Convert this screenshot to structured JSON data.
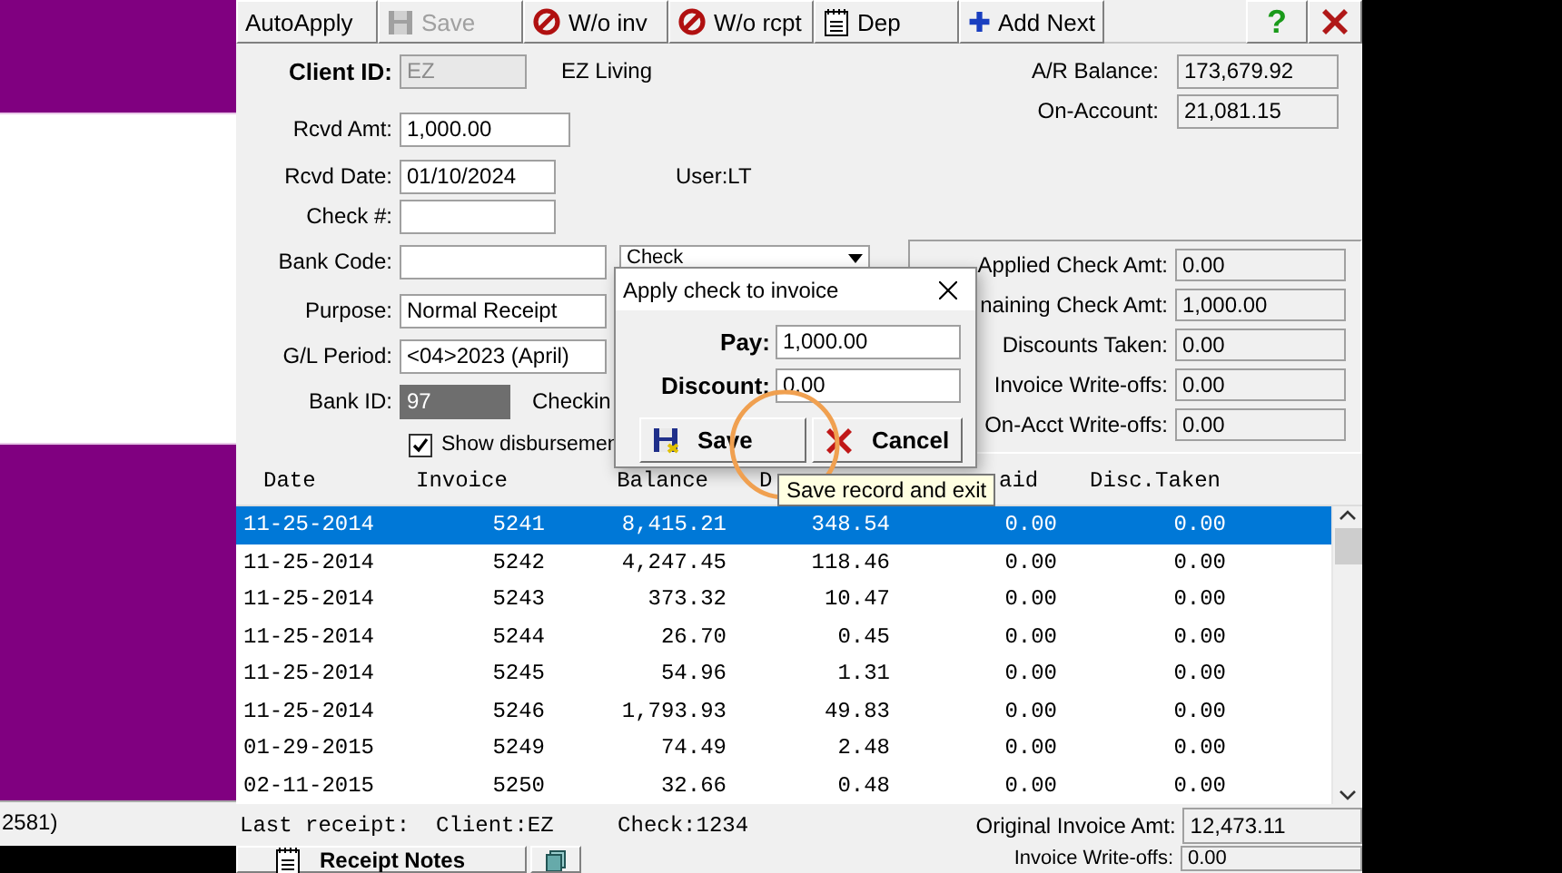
{
  "side_panel": {
    "status_text": "2581)"
  },
  "toolbar": {
    "buttons": [
      {
        "label": "AutoApply",
        "kind": "text",
        "disabled": false
      },
      {
        "label": "Save",
        "kind": "save",
        "disabled": true
      },
      {
        "label": "W/o inv",
        "kind": "writeoff",
        "disabled": false
      },
      {
        "label": "W/o rcpt",
        "kind": "writeoff",
        "disabled": false
      },
      {
        "label": "Dep",
        "kind": "notepad",
        "disabled": false
      },
      {
        "label": "Add Next",
        "kind": "plus",
        "disabled": false
      }
    ],
    "help": "?"
  },
  "form": {
    "client": {
      "label": "Client ID:",
      "value": "EZ",
      "name": "EZ Living"
    },
    "rcvd_amt": {
      "label": "Rcvd Amt:",
      "value": "1,000.00"
    },
    "rcvd_date": {
      "label": "Rcvd Date:",
      "value": "01/10/2024",
      "user": "User:LT"
    },
    "check_no": {
      "label": "Check #:"
    },
    "bank_code": {
      "label": "Bank Code:",
      "dropdown": "Check"
    },
    "purpose": {
      "label": "Purpose:",
      "value": "Normal Receipt"
    },
    "gl_period": {
      "label": "G/L Period:",
      "value": "<04>2023 (April)"
    },
    "bank_id": {
      "label": "Bank ID:",
      "value": "97",
      "account": "Checkin"
    },
    "show_disbursements": {
      "label": "Show disbursemen",
      "checked": true
    }
  },
  "balances": [
    {
      "label": "A/R Balance:",
      "value": "173,679.92"
    },
    {
      "label": "On-Account:",
      "value": "21,081.15"
    }
  ],
  "totals": [
    {
      "label": "Applied Check Amt:",
      "value": "0.00"
    },
    {
      "label": "naining Check Amt:",
      "value": "1,000.00"
    },
    {
      "label": "Discounts Taken:",
      "value": "0.00"
    },
    {
      "label": "Invoice Write-offs:",
      "value": "0.00"
    },
    {
      "label": "On-Acct Write-offs:",
      "value": "0.00"
    }
  ],
  "table": {
    "columns": [
      "Date",
      "Invoice",
      "Balance",
      "D",
      "aid",
      "Disc.Taken"
    ],
    "rows": [
      {
        "cells": [
          "11-25-2014",
          "5241",
          "8,415.21",
          "348.54",
          "0.00",
          "0.00"
        ],
        "selected": true
      },
      {
        "cells": [
          "11-25-2014",
          "5242",
          "4,247.45",
          "118.46",
          "0.00",
          "0.00"
        ],
        "selected": false
      },
      {
        "cells": [
          "11-25-2014",
          "5243",
          "373.32",
          "10.47",
          "0.00",
          "0.00"
        ],
        "selected": false
      },
      {
        "cells": [
          "11-25-2014",
          "5244",
          "26.70",
          "0.45",
          "0.00",
          "0.00"
        ],
        "selected": false
      },
      {
        "cells": [
          "11-25-2014",
          "5245",
          "54.96",
          "1.31",
          "0.00",
          "0.00"
        ],
        "selected": false
      },
      {
        "cells": [
          "11-25-2014",
          "5246",
          "1,793.93",
          "49.83",
          "0.00",
          "0.00"
        ],
        "selected": false
      },
      {
        "cells": [
          "01-29-2015",
          "5249",
          "74.49",
          "2.48",
          "0.00",
          "0.00"
        ],
        "selected": false
      },
      {
        "cells": [
          "02-11-2015",
          "5250",
          "32.66",
          "0.48",
          "0.00",
          "0.00"
        ],
        "selected": false
      }
    ]
  },
  "footer": {
    "last_receipt": "Last receipt:  Client:EZ",
    "check": "Check:1234",
    "original_invoice": {
      "label": "Original Invoice Amt:",
      "value": "12,473.11"
    },
    "notes_button": "Receipt Notes",
    "invoice_writeoffs": {
      "label": "Invoice Write-offs:",
      "value": "0.00"
    }
  },
  "dialog": {
    "title": "Apply check to invoice",
    "fields": [
      {
        "label": "Pay:",
        "value": "1,000.00"
      },
      {
        "label": "Discount:",
        "value": "0.00"
      }
    ],
    "buttons": [
      {
        "label": "Save",
        "kind": "save"
      },
      {
        "label": "Cancel",
        "kind": "cancel"
      }
    ]
  },
  "tooltip": "Save record and exit"
}
